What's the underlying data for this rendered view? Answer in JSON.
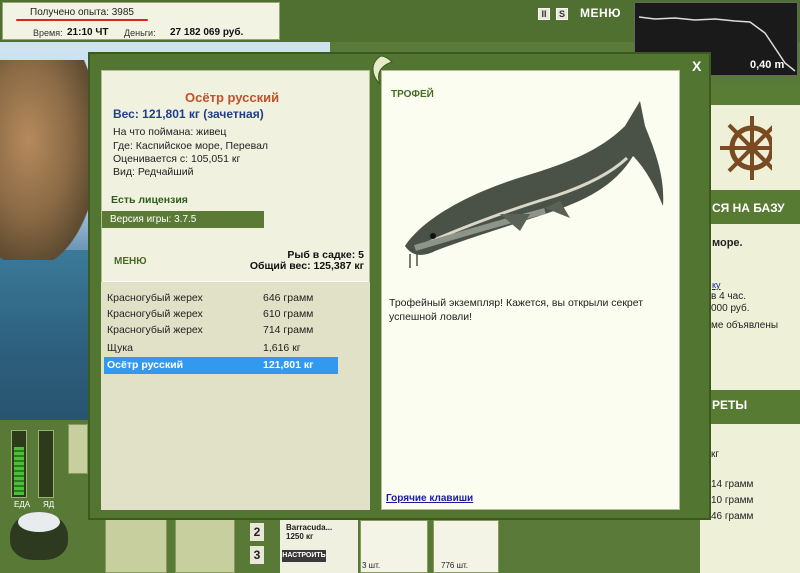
{
  "topbar": {
    "experience": "Получено опыта: 3985",
    "time_label": "Время:",
    "time_value": "21:10 ЧТ",
    "money_label": "Деньги:",
    "money_value": "27 182 069 руб.",
    "menu": "МЕНЮ",
    "pause_glyph": "II",
    "sound_glyph": "S",
    "depth": "0,40 m"
  },
  "dialog": {
    "close": "X",
    "fish": {
      "title": "Осётр русский",
      "weight": "Вес: 121,801 кг (зачетная)",
      "bait": "На что поймана: живец",
      "location": "Где: Каспийское море, Перевал",
      "valued_from": "Оценивается с: 105,051 кг",
      "kind": "Вид: Редчайший"
    },
    "license": "Есть лицензия",
    "version": "Версия игры: 3.7.5",
    "menu_link": "МЕНЮ",
    "cage_count": "Рыб в садке: 5",
    "cage_weight": "Общий вес: 125,387 кг",
    "catch_list": [
      {
        "name": "Красногубый жерех",
        "weight": "646 грамм"
      },
      {
        "name": "Красногубый жерех",
        "weight": "610 грамм"
      },
      {
        "name": "Красногубый жерех",
        "weight": "714 грамм"
      },
      {
        "name": "Щука",
        "weight": "1,616 кг"
      },
      {
        "name": "Осётр русский",
        "weight": "121,801 кг"
      }
    ],
    "trophy_title": "ТРОФЕЙ",
    "trophy_text": "Трофейный экземпляр! Кажется, вы открыли секрет успешной ловли!",
    "hotkeys": "Горячие клавиши"
  },
  "right_panel": {
    "go_base": "СЯ НА БАЗУ",
    "sea": "море.",
    "link": "ку",
    "line1": "в 4 час.",
    "line2": "000 руб.",
    "line3": "ме объявлены",
    "secrets": "РЕТЫ",
    "kg": "кг",
    "g1": "14 грамм",
    "g2": "10 грамм",
    "g3": "46 грамм"
  },
  "bottombar": {
    "food_label": "ЕДА",
    "poison_label": "ЯД",
    "slot2": "2",
    "slot3": "3",
    "rod_name": "Barracuda...",
    "rod_weight": "1250 кг",
    "setup": "НАСТРОИТЬ",
    "count1": "3 шт.",
    "count2": "776 шт."
  },
  "colors": {
    "frame_green": "#527532",
    "selected_row": "#3399ee",
    "fish_title": "#c0522a",
    "fish_weight": "#1e3e8a"
  }
}
